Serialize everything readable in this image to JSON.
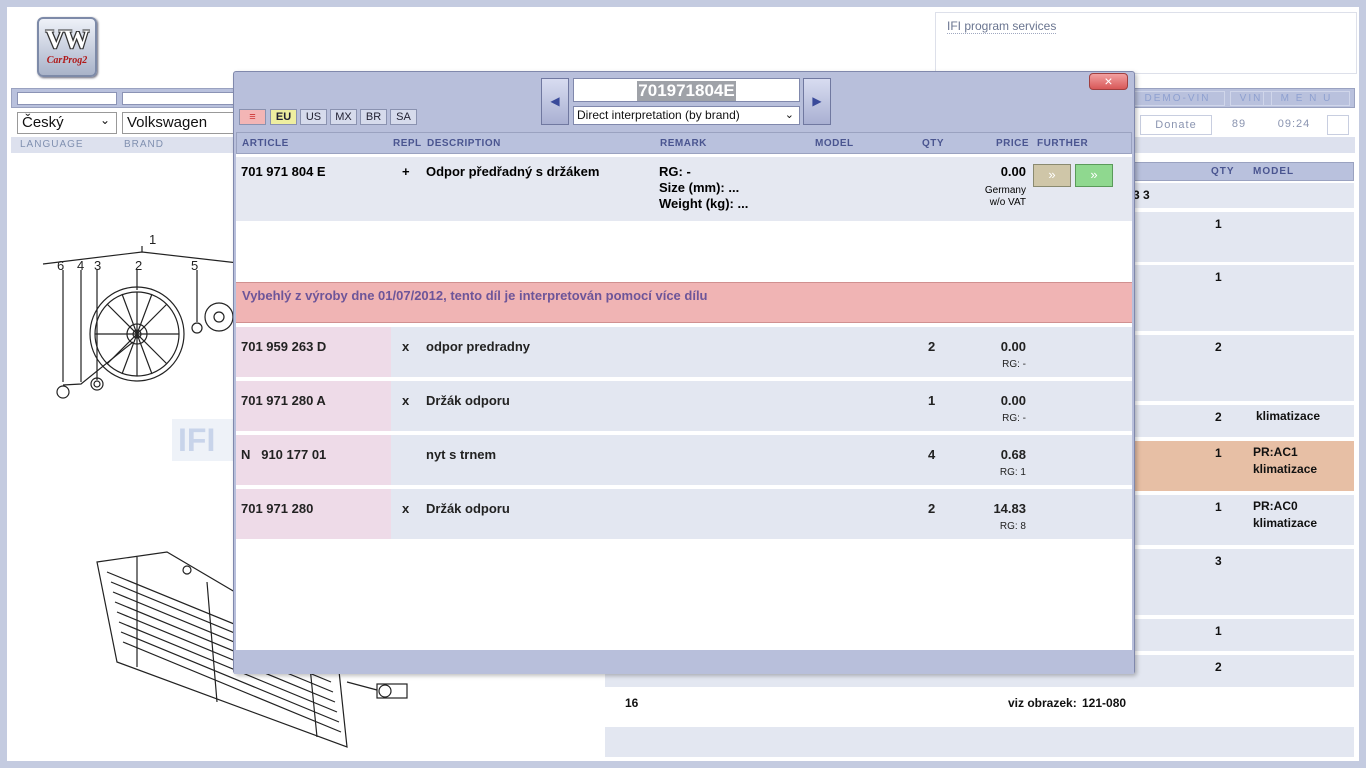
{
  "app": {
    "logo_main": "VW",
    "logo_sub": "CarProg2",
    "services_link": "IFI program services"
  },
  "topbar": {
    "demo_vin": "DEMO-VIN",
    "vin": "VIN",
    "menu": "M E N U",
    "donate": "Donate",
    "count": "89",
    "time": "09:24"
  },
  "selectors": {
    "language": "Český",
    "brand": "Volkswagen",
    "language_label": "LANGUAGE",
    "brand_label": "BRAND"
  },
  "background_table": {
    "headers": {
      "qty": "QTY",
      "model": "MODEL"
    },
    "partial_text": "3 3",
    "rows": [
      {
        "qty": "1",
        "model": ""
      },
      {
        "qty": "1",
        "model": ""
      },
      {
        "qty": "2",
        "model": ""
      },
      {
        "qty": "2",
        "model": "klimatizace"
      },
      {
        "qty": "1",
        "model": "PR:AC1\nklimatizace"
      },
      {
        "qty": "1",
        "model": "PR:AC0\nklimatizace"
      },
      {
        "qty": "3",
        "model": ""
      },
      {
        "qty": "1",
        "model": ""
      },
      {
        "qty": "2",
        "model": ""
      }
    ],
    "footer_num": "16",
    "footer_ref_label": "viz obrazek:",
    "footer_ref_value": "121-080"
  },
  "diagram": {
    "callouts": [
      "1",
      "6",
      "4",
      "3",
      "2",
      "5"
    ],
    "watermark": "IFI"
  },
  "modal": {
    "close_label": "×",
    "markets": [
      {
        "label": "≡",
        "active": false
      },
      {
        "label": "EU",
        "active": true
      },
      {
        "label": "US",
        "active": false
      },
      {
        "label": "MX",
        "active": false
      },
      {
        "label": "BR",
        "active": false
      },
      {
        "label": "SA",
        "active": false
      }
    ],
    "prev_label": "◀",
    "next_label": "▶",
    "search_value": "701971804E",
    "interpretation": "Direct interpretation (by brand)",
    "columns": {
      "article": "ARTICLE",
      "repl": "REPL",
      "description": "DESCRIPTION",
      "remark": "REMARK",
      "model": "MODEL",
      "qty": "QTY",
      "price": "PRICE",
      "further": "FURTHER"
    },
    "main_part": {
      "article": "701 971 804 E",
      "repl": "+",
      "description": "Odpor předřadný s držákem",
      "remark_rg": "RG: -",
      "remark_size": "Size (mm): ...",
      "remark_weight": "Weight (kg): ...",
      "price": "0.00",
      "price_region": "Germany",
      "price_vat": "w/o VAT",
      "further_btn1": "»",
      "further_btn2": "»"
    },
    "notice": "Vybehlý z výroby dne 01/07/2012, tento díl je interpretován pomocí více dílu",
    "sub_parts": [
      {
        "article": "701 959 263 D",
        "repl": "x",
        "description": "odpor predradny",
        "qty": "2",
        "price": "0.00",
        "rg": "RG: -"
      },
      {
        "article": "701 971 280 A",
        "repl": "x",
        "description": "Držák odporu",
        "qty": "1",
        "price": "0.00",
        "rg": "RG: -"
      },
      {
        "article": "N   910 177 01",
        "repl": "",
        "description": "nyt s trnem",
        "qty": "4",
        "price": "0.68",
        "rg": "RG: 1"
      },
      {
        "article": "701 971 280",
        "repl": "x",
        "description": "Držák odporu",
        "qty": "2",
        "price": "14.83",
        "rg": "RG: 8"
      }
    ]
  },
  "colors": {
    "header_bar": "#b9c1dd",
    "row_bg": "#e3e7f1",
    "notice_bg": "#f0b4b4",
    "highlight_row": "#e7bfa5"
  }
}
